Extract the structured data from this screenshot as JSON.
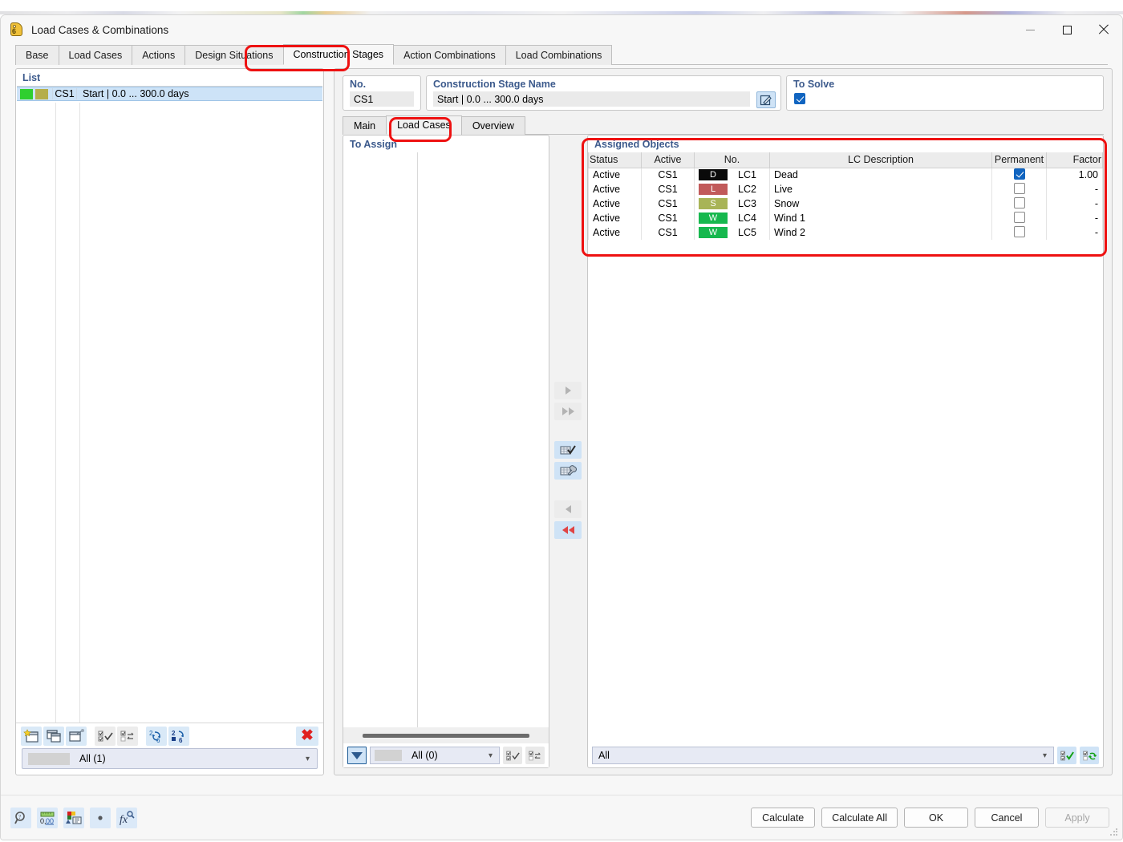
{
  "window": {
    "title": "Load Cases & Combinations",
    "icon": "load-case-tag-icon",
    "minimize": "—",
    "maximize": "□",
    "close": "✕"
  },
  "main_tabs": [
    {
      "label": "Base",
      "active": false,
      "highlighted": false
    },
    {
      "label": "Load Cases",
      "active": false,
      "highlighted": false
    },
    {
      "label": "Actions",
      "active": false,
      "highlighted": false
    },
    {
      "label": "Design Situations",
      "active": false,
      "highlighted": false
    },
    {
      "label": "Construction Stages",
      "active": true,
      "highlighted": true
    },
    {
      "label": "Action Combinations",
      "active": false,
      "highlighted": false
    },
    {
      "label": "Load Combinations",
      "active": false,
      "highlighted": false
    }
  ],
  "left_panel": {
    "caption": "List",
    "rows": [
      {
        "swatch_1": "#2fcf2f",
        "swatch_2": "#b5ae4a",
        "no": "CS1",
        "name": "Start | 0.0 ... 300.0 days",
        "selected": true
      }
    ],
    "toolbar": [
      {
        "name": "new-stage-button",
        "icon": "new-window-star-icon"
      },
      {
        "name": "copy-stage-button",
        "icon": "copy-window-icon"
      },
      {
        "name": "import-stage-button",
        "icon": "window-import-icon"
      },
      {
        "name": "select-all-button",
        "icon": "checklist-check-icon"
      },
      {
        "name": "invert-selection-button",
        "icon": "checklist-swap-icon"
      },
      {
        "name": "renumber-button",
        "icon": "renumber-arrows-icon"
      },
      {
        "name": "sequence-button",
        "icon": "sequence-2-6-icon"
      },
      {
        "name": "delete-stage-button",
        "icon": "red-x-icon"
      }
    ],
    "filter_combo": {
      "value": "All (1)",
      "caret": "∨"
    }
  },
  "stage_fields": {
    "no_label": "No.",
    "no_value": "CS1",
    "name_label": "Construction Stage Name",
    "name_value": "Start | 0.0 ... 300.0 days",
    "edit_icon": "edit-pencil-icon",
    "solve_label": "To Solve",
    "solve_checked": true
  },
  "inner_tabs": [
    {
      "label": "Main",
      "active": false,
      "highlighted": false
    },
    {
      "label": "Load Cases",
      "active": true,
      "highlighted": true
    },
    {
      "label": "Overview",
      "active": false,
      "highlighted": false
    }
  ],
  "to_assign": {
    "caption": "To Assign",
    "rows": [],
    "filter_icon": "funnel-filter-icon",
    "combo": {
      "value": "All (0)",
      "caret": "∨"
    },
    "buttons": [
      {
        "name": "assign-select-all-button",
        "icon": "checklist-check-icon"
      },
      {
        "name": "assign-invert-button",
        "icon": "checklist-swap-icon"
      }
    ]
  },
  "transfer_buttons": [
    {
      "name": "move-right-button",
      "icon": "triangle-right-icon",
      "style": "grey"
    },
    {
      "name": "move-all-right-button",
      "icon": "double-triangle-right-icon",
      "style": "grey"
    },
    {
      "name": "assign-new-load-case-button",
      "icon": "grid-check-icon",
      "style": "blue"
    },
    {
      "name": "edit-load-case-button",
      "icon": "grid-wrench-icon",
      "style": "blue"
    },
    {
      "name": "move-left-button",
      "icon": "triangle-left-icon",
      "style": "grey"
    },
    {
      "name": "move-all-left-button",
      "icon": "double-triangle-left-red-icon",
      "style": "blue"
    }
  ],
  "assigned_objects": {
    "caption": "Assigned Objects",
    "columns": [
      "Status",
      "Active",
      "No.",
      "LC Description",
      "Permanent",
      "Factor"
    ],
    "rows": [
      {
        "status": "Active",
        "active": "CS1",
        "badge_text": "D",
        "badge_color": "#0a0a0a",
        "no": "LC1",
        "description": "Dead",
        "permanent": true,
        "factor": "1.00"
      },
      {
        "status": "Active",
        "active": "CS1",
        "badge_text": "L",
        "badge_color": "#c15a5a",
        "no": "LC2",
        "description": "Live",
        "permanent": false,
        "factor": "-"
      },
      {
        "status": "Active",
        "active": "CS1",
        "badge_text": "S",
        "badge_color": "#a8b457",
        "no": "LC3",
        "description": "Snow",
        "permanent": false,
        "factor": "-"
      },
      {
        "status": "Active",
        "active": "CS1",
        "badge_text": "W",
        "badge_color": "#16b84e",
        "no": "LC4",
        "description": "Wind 1",
        "permanent": false,
        "factor": "-"
      },
      {
        "status": "Active",
        "active": "CS1",
        "badge_text": "W",
        "badge_color": "#16b84e",
        "no": "LC5",
        "description": "Wind 2",
        "permanent": false,
        "factor": "-"
      }
    ],
    "combo": {
      "value": "All",
      "caret": "∨"
    },
    "buttons": [
      {
        "name": "assigned-select-all-button",
        "icon": "checklist-check-green-icon"
      },
      {
        "name": "assigned-refresh-button",
        "icon": "checklist-refresh-green-icon"
      }
    ]
  },
  "footer": {
    "tools": [
      {
        "name": "info-magnifier-button",
        "icon": "magnifier-question-icon"
      },
      {
        "name": "units-button",
        "icon": "ruler-decimal-icon"
      },
      {
        "name": "display-properties-button",
        "icon": "color-panel-icon"
      },
      {
        "name": "dot-button",
        "icon": "dot-icon"
      },
      {
        "name": "formula-button",
        "icon": "fx-icon"
      }
    ],
    "buttons": [
      {
        "label": "Calculate",
        "name": "calculate-button",
        "disabled": false
      },
      {
        "label": "Calculate All",
        "name": "calculate-all-button",
        "disabled": false
      },
      {
        "label": "OK",
        "name": "ok-button",
        "disabled": false
      },
      {
        "label": "Cancel",
        "name": "cancel-button",
        "disabled": false
      },
      {
        "label": "Apply",
        "name": "apply-button",
        "disabled": true
      }
    ]
  },
  "annotations": {
    "ring_1": "construction-stages-tab-highlight",
    "ring_2": "load-cases-subtab-highlight",
    "ring_3": "assigned-objects-table-highlight"
  }
}
